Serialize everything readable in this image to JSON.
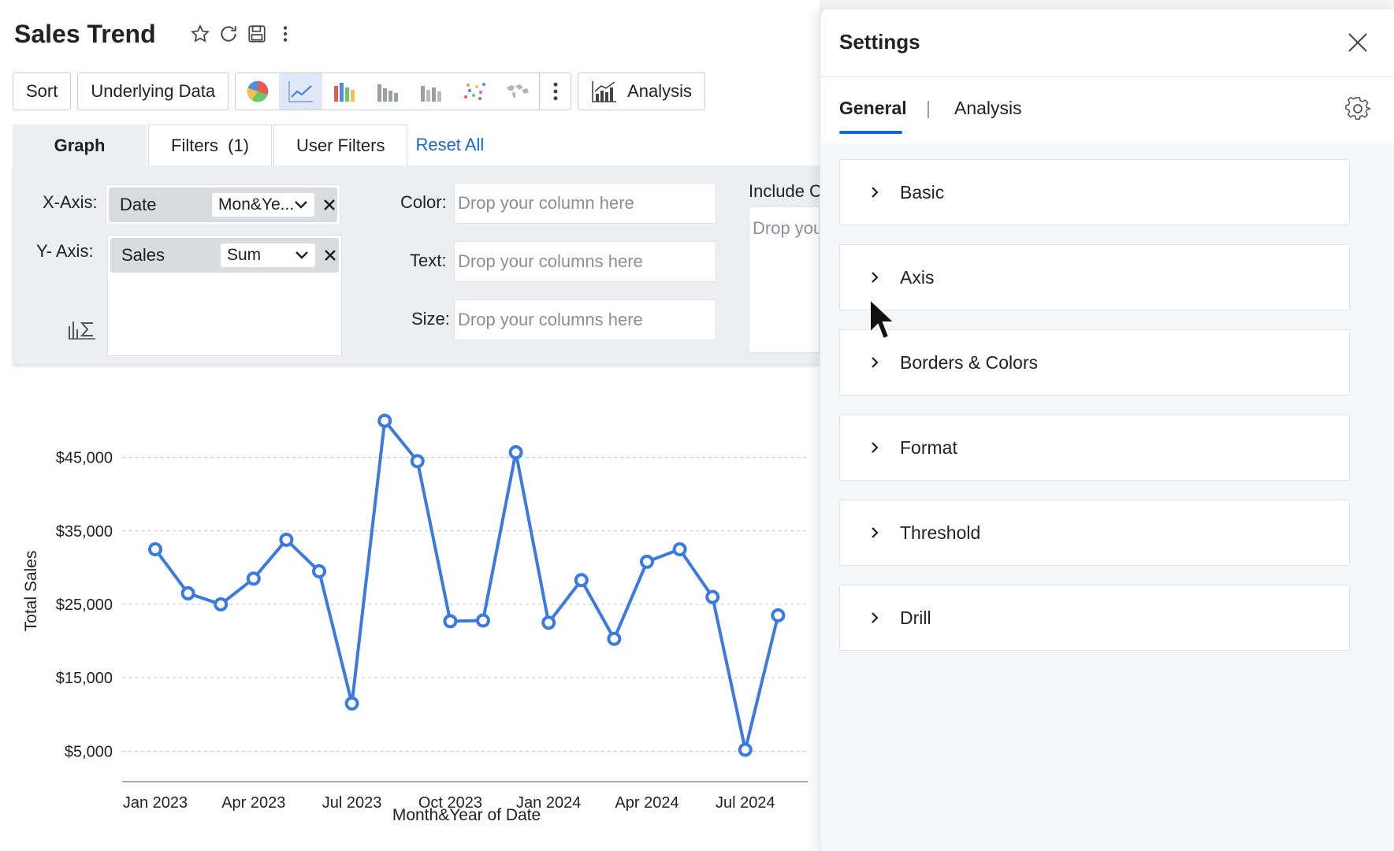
{
  "report": {
    "title": "Sales Trend",
    "title_icons": [
      "star-icon",
      "refresh-icon",
      "save-icon",
      "more-vertical-icon"
    ]
  },
  "toolbar": {
    "sort_label": "Sort",
    "underlying_data_label": "Underlying Data",
    "chart_types": [
      "pie-chart-icon",
      "line-chart-icon",
      "bar-chart-icon",
      "column-chart-icon",
      "stacked-chart-icon",
      "scatter-chart-icon",
      "map-chart-icon"
    ],
    "active_chart_type": "line-chart-icon",
    "analysis_label": "Analysis"
  },
  "tabs": {
    "graph": "Graph",
    "filters": "Filters  (1)",
    "user_filters": "User Filters",
    "reset_all": "Reset All"
  },
  "shelf": {
    "x_axis_label": "X-Axis:",
    "x_axis_column": "Date",
    "x_axis_agg": "Mon&Ye...",
    "y_axis_label": "Y- Axis:",
    "y_axis_column": "Sales",
    "y_axis_agg": "Sum",
    "color_label": "Color:",
    "color_placeholder": "Drop your column here",
    "text_label": "Text:",
    "text_placeholder": "Drop your columns here",
    "size_label": "Size:",
    "size_placeholder": "Drop your columns here",
    "include_label": "Include C",
    "include_placeholder": "Drop you"
  },
  "chart_data": {
    "type": "line",
    "title": "",
    "xlabel": "Month&Year of Date",
    "ylabel": "Total Sales",
    "x_tick_labels": [
      "Jan 2023",
      "Apr 2023",
      "Jul 2023",
      "Oct 2023",
      "Jan 2024",
      "Apr 2024",
      "Jul 2024"
    ],
    "y_tick_labels": [
      "$45,000",
      "$35,000",
      "$25,000",
      "$15,000",
      "$5,000"
    ],
    "y_ticks": [
      45000,
      35000,
      25000,
      15000,
      5000
    ],
    "ylim": [
      3000,
      51500
    ],
    "grid": true,
    "color": "#3b7be0",
    "x": [
      "Jan 2023",
      "Feb 2023",
      "Mar 2023",
      "Apr 2023",
      "May 2023",
      "Jun 2023",
      "Jul 2023",
      "Aug 2023",
      "Sep 2023",
      "Oct 2023",
      "Nov 2023",
      "Dec 2023",
      "Jan 2024",
      "Feb 2024",
      "Mar 2024",
      "Apr 2024",
      "May 2024",
      "Jun 2024",
      "Jul 2024",
      "Aug 2024"
    ],
    "values": [
      32500,
      26500,
      25000,
      28500,
      33800,
      29500,
      11500,
      50000,
      44500,
      22700,
      22800,
      45700,
      22500,
      28300,
      20300,
      30800,
      32500,
      26000,
      5200,
      23500
    ]
  },
  "settings": {
    "title": "Settings",
    "tab_general": "General",
    "tab_separator": "|",
    "tab_analysis": "Analysis",
    "sections": [
      "Basic",
      "Axis",
      "Borders & Colors",
      "Format",
      "Threshold",
      "Drill"
    ]
  },
  "colors": {
    "accent": "#1a66d8",
    "line": "#3b7be0"
  }
}
